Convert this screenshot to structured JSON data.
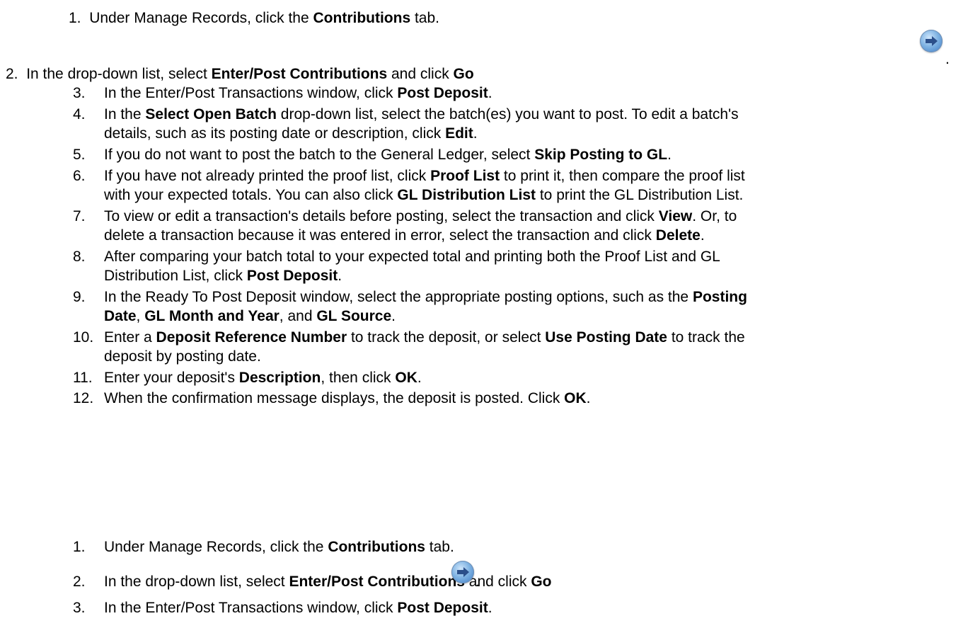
{
  "top": {
    "s1": {
      "n": "1.",
      "a": "Under Manage Records, click the ",
      "b": "Contributions",
      "c": " tab."
    },
    "s2": {
      "n": "2.",
      "a": "In the drop-down list, select ",
      "b": "Enter/Post Contributions",
      "c": " and click ",
      "d": "Go"
    },
    "s3": {
      "n": "3.",
      "a": "In the Enter/Post Transactions window, click ",
      "b": "Post Deposit",
      "c": "."
    },
    "s4": {
      "n": "4.",
      "a": "In the ",
      "b": "Select Open Batch",
      "c": " drop-down list, select the batch(es) you want to post. To edit a batch's",
      "l2a": "details, such as its posting date or description, click ",
      "l2b": "Edit",
      "l2c": "."
    },
    "s5": {
      "n": "5.",
      "a": "If you do not want to post the batch to the General Ledger, select ",
      "b": "Skip Posting to GL",
      "c": "."
    },
    "s6": {
      "n": "6.",
      "a": "If you have not already printed the proof list, click ",
      "b": "Proof List",
      "c": " to print it, then compare the proof list",
      "l2a": "with your expected totals. You can also click ",
      "l2b": "GL Distribution List",
      "l2c": " to print the GL Distribution List."
    },
    "s7": {
      "n": "7.",
      "a": "To view or edit a transaction's details before posting, select the transaction and click ",
      "b": "View",
      "c": ". Or, to",
      "l2a": "delete a transaction because it was entered in error, select the transaction and click ",
      "l2b": "Delete",
      "l2c": "."
    },
    "s8": {
      "n": "8.",
      "a": "After comparing your batch total to your expected total and printing both the Proof List and GL",
      "l2a": "Distribution List, click ",
      "l2b": "Post Deposit",
      "l2c": "."
    },
    "s9": {
      "n": "9.",
      "a": "In the Ready To Post Deposit window, select the appropriate posting options, such as the ",
      "b": "Posting",
      "l2a": "Date",
      "l2b": ", ",
      "l2c": "GL Month and Year",
      "l2d": ", and ",
      "l2e": "GL Source",
      "l2f": "."
    },
    "s10": {
      "n": "10.",
      "a": "Enter a ",
      "b": "Deposit Reference Number",
      "c": " to track the deposit, or select ",
      "d": "Use Posting Date",
      "e": " to track the",
      "l2a": "deposit by posting date."
    },
    "s11": {
      "n": "11.",
      "a": "Enter your deposit's ",
      "b": "Description",
      "c": ", then click ",
      "d": "OK",
      "e": "."
    },
    "s12": {
      "n": "12.",
      "a": "When the confirmation message displays, the deposit is posted. Click ",
      "b": "OK",
      "c": "."
    }
  },
  "bottom": {
    "s1": {
      "n": "1.",
      "a": "Under Manage Records, click the ",
      "b": "Contributions",
      "c": " tab."
    },
    "s2": {
      "n": "2.",
      "a": "In the drop-down list, select ",
      "b": "Enter/Post Contributions",
      "c": " and click ",
      "d": "Go",
      "e": "."
    },
    "s3": {
      "n": "3.",
      "a": "In the Enter/Post Transactions window, click ",
      "b": "Post Deposit",
      "c": "."
    }
  },
  "stray_period": ".",
  "icons": {
    "go": "go-arrow-icon"
  }
}
